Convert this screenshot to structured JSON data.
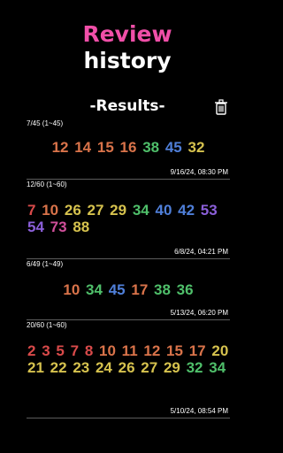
{
  "header": {
    "title_line1": "Review",
    "title_line2": "history"
  },
  "results": {
    "title": "-Results-",
    "delete_icon": "trash-icon"
  },
  "entries": [
    {
      "game": "7/45 (1~45)",
      "numbers": [
        {
          "value": "12",
          "color": "#d9734a"
        },
        {
          "value": "14",
          "color": "#d9734a"
        },
        {
          "value": "15",
          "color": "#d9734a"
        },
        {
          "value": "16",
          "color": "#d9734a"
        },
        {
          "value": "38",
          "color": "#4fbf6a"
        },
        {
          "value": "45",
          "color": "#4f7fd9"
        },
        {
          "value": "32",
          "color": "#d6c24e"
        }
      ],
      "date": "9/16/24, 08:30 PM"
    },
    {
      "game": "12/60 (1~60)",
      "numbers": [
        {
          "value": "7",
          "color": "#d94a4a"
        },
        {
          "value": "10",
          "color": "#d9734a"
        },
        {
          "value": "26",
          "color": "#d6c24e"
        },
        {
          "value": "27",
          "color": "#d6c24e"
        },
        {
          "value": "29",
          "color": "#d6c24e"
        },
        {
          "value": "34",
          "color": "#4fbf6a"
        },
        {
          "value": "40",
          "color": "#4f7fd9"
        },
        {
          "value": "42",
          "color": "#4f7fd9"
        },
        {
          "value": "53",
          "color": "#8b5fd9"
        },
        {
          "value": "54",
          "color": "#8b5fd9"
        },
        {
          "value": "73",
          "color": "#d04f9a"
        },
        {
          "value": "88",
          "color": "#d6c24e"
        }
      ],
      "date": "6/8/24, 04:21 PM"
    },
    {
      "game": "6/49 (1~49)",
      "numbers": [
        {
          "value": "10",
          "color": "#d9734a"
        },
        {
          "value": "34",
          "color": "#4fbf6a"
        },
        {
          "value": "45",
          "color": "#4f7fd9"
        },
        {
          "value": "17",
          "color": "#d9734a"
        },
        {
          "value": "38",
          "color": "#4fbf6a"
        },
        {
          "value": "36",
          "color": "#4fbf6a"
        }
      ],
      "date": "5/13/24, 06:20 PM"
    },
    {
      "game": "20/60 (1~60)",
      "numbers": [
        {
          "value": "2",
          "color": "#d94a4a"
        },
        {
          "value": "3",
          "color": "#d94a4a"
        },
        {
          "value": "5",
          "color": "#d94a4a"
        },
        {
          "value": "7",
          "color": "#d94a4a"
        },
        {
          "value": "8",
          "color": "#d94a4a"
        },
        {
          "value": "10",
          "color": "#d9734a"
        },
        {
          "value": "11",
          "color": "#d9734a"
        },
        {
          "value": "12",
          "color": "#d9734a"
        },
        {
          "value": "15",
          "color": "#d9734a"
        },
        {
          "value": "17",
          "color": "#d9734a"
        },
        {
          "value": "20",
          "color": "#d6c24e"
        },
        {
          "value": "21",
          "color": "#d6c24e"
        },
        {
          "value": "22",
          "color": "#d6c24e"
        },
        {
          "value": "23",
          "color": "#d6c24e"
        },
        {
          "value": "24",
          "color": "#d6c24e"
        },
        {
          "value": "26",
          "color": "#d6c24e"
        },
        {
          "value": "27",
          "color": "#d6c24e"
        },
        {
          "value": "29",
          "color": "#d6c24e"
        },
        {
          "value": "32",
          "color": "#4fbf6a"
        },
        {
          "value": "34",
          "color": "#4fbf6a"
        }
      ],
      "date": "5/10/24, 08:54 PM"
    }
  ]
}
